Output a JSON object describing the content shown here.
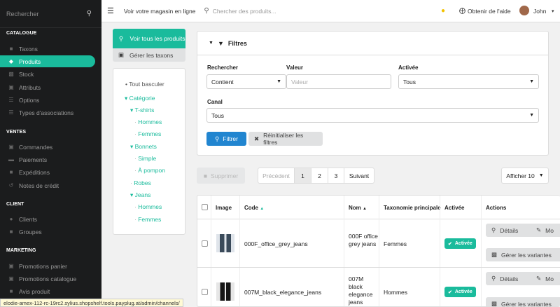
{
  "sidebar": {
    "search_placeholder": "Rechercher",
    "sections": [
      {
        "title": "CATALOGUE"
      },
      {
        "title": "VENTES"
      },
      {
        "title": "CLIENT"
      },
      {
        "title": "MARKETING"
      }
    ],
    "items": [
      {
        "label": "Taxons"
      },
      {
        "label": "Produits"
      },
      {
        "label": "Stock"
      },
      {
        "label": "Attributs"
      },
      {
        "label": "Options"
      },
      {
        "label": "Types d'associations"
      },
      {
        "label": "Commandes"
      },
      {
        "label": "Paiements"
      },
      {
        "label": "Expéditions"
      },
      {
        "label": "Notes de crédit"
      },
      {
        "label": "Clients"
      },
      {
        "label": "Groupes"
      },
      {
        "label": "Promotions panier"
      },
      {
        "label": "Promotions catalogue"
      },
      {
        "label": "Avis produit"
      }
    ]
  },
  "topbar": {
    "store_link": "Voir votre magasin en ligne",
    "search_placeholder": "Chercher des produits...",
    "help": "Obtenir de l'aide",
    "user": "John"
  },
  "taxon_panel": {
    "view_all": "Voir tous les produits",
    "manage": "Gérer les taxons",
    "tree": [
      {
        "label": "Tout basculer"
      },
      {
        "label": "Catégorie"
      },
      {
        "label": "T-shirts"
      },
      {
        "label": "Hommes"
      },
      {
        "label": "Femmes"
      },
      {
        "label": "Bonnets"
      },
      {
        "label": "Simple"
      },
      {
        "label": "À pompon"
      },
      {
        "label": "Robes"
      },
      {
        "label": "Jeans"
      },
      {
        "label": "Hommes"
      },
      {
        "label": "Femmes"
      }
    ]
  },
  "filters": {
    "title": "Filtres",
    "search_label": "Rechercher",
    "search_mode": "Contient",
    "value_label": "Valeur",
    "value_placeholder": "Valeur",
    "enabled_label": "Activée",
    "enabled_value": "Tous",
    "channel_label": "Canal",
    "channel_value": "Tous",
    "filter_btn": "Filtrer",
    "reset_btn": "Réinitialiser les filtres"
  },
  "toolbar": {
    "delete": "Supprimer",
    "prev": "Précédent",
    "pages": [
      "1",
      "2",
      "3"
    ],
    "next": "Suivant",
    "show": "Afficher 10"
  },
  "table": {
    "headers": [
      "Image",
      "Code",
      "Nom",
      "Taxonomie principale",
      "Activée",
      "Actions"
    ],
    "rows": [
      {
        "code": "000F_office_grey_jeans",
        "name": "000F office grey jeans",
        "taxon": "Femmes",
        "status": "Activée",
        "details": "Détails",
        "modify": "Mo",
        "variants": "Gérer les variantes"
      },
      {
        "code": "007M_black_elegance_jeans",
        "name": "007M black elegance jeans",
        "taxon": "Hommes",
        "status": "Activée",
        "details": "Détails",
        "modify": "Mo",
        "variants": "Gérer les variantes"
      }
    ]
  },
  "statusbar": "elodie-amex-112-rc-19rc2.sylius.shopshelf.tools.payplug.at/admin/channels/"
}
